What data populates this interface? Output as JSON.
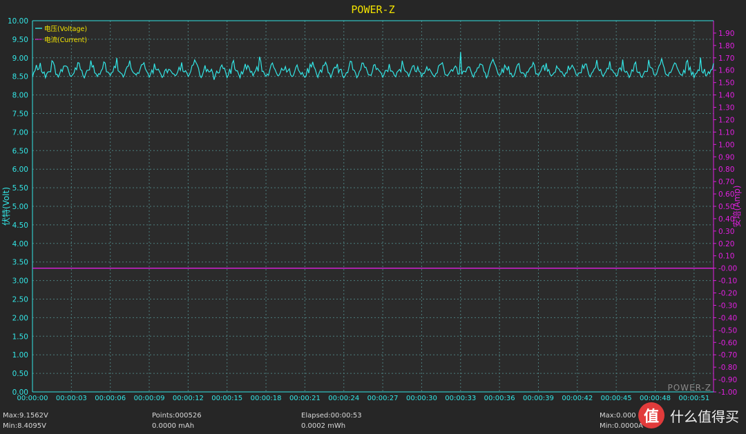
{
  "chart_data": {
    "type": "line",
    "title": "POWER-Z",
    "ylabel": "伏特(Volt)",
    "y2label": "安培(Amp)",
    "ylim": [
      0,
      10
    ],
    "y2lim": [
      -1.0,
      2.0
    ],
    "yticks": [
      "0.00",
      "0.50",
      "1.00",
      "1.50",
      "2.00",
      "2.50",
      "3.00",
      "3.50",
      "4.00",
      "4.50",
      "5.00",
      "5.50",
      "6.00",
      "6.50",
      "7.00",
      "7.50",
      "8.00",
      "8.50",
      "9.00",
      "9.50",
      "10.00"
    ],
    "y2ticks": [
      "-1.00",
      "-0.90",
      "-0.80",
      "-0.70",
      "-0.60",
      "-0.50",
      "-0.40",
      "-0.30",
      "-0.20",
      "-0.10",
      "-0.00",
      "0.10",
      "0.20",
      "0.30",
      "0.40",
      "0.50",
      "0.60",
      "0.70",
      "0.80",
      "0.90",
      "1.00",
      "1.10",
      "1.20",
      "1.30",
      "1.40",
      "1.50",
      "1.60",
      "1.70",
      "1.80",
      "1.90"
    ],
    "xticks": [
      "00:00:00",
      "00:00:03",
      "00:00:06",
      "00:00:09",
      "00:00:12",
      "00:00:15",
      "00:00:18",
      "00:00:21",
      "00:00:24",
      "00:00:27",
      "00:00:30",
      "00:00:33",
      "00:00:36",
      "00:00:39",
      "00:00:42",
      "00:00:45",
      "00:00:48",
      "00:00:51"
    ],
    "xlim_seconds": [
      0,
      52.5
    ],
    "grid": true,
    "legend_placement": "top-left",
    "series": [
      {
        "name": "电压(Voltage)",
        "axis": "left",
        "color": "#33e6e6",
        "min": 8.4095,
        "max": 9.1562,
        "baseline": 8.5,
        "period_s": 1.0
      },
      {
        "name": "电流(Current)",
        "axis": "right",
        "color": "#e020e0",
        "constant": 0.0
      }
    ]
  },
  "colors": {
    "background": "#262626",
    "plot_bg": "#2b2b2b",
    "grid": "#4d7f7f",
    "axis_left": "#33e6e6",
    "axis_right": "#e020e0",
    "title": "#f2e200"
  },
  "footer": {
    "max": "Max:9.1562V",
    "min": "Min:8.4095V",
    "points": "Points:000526",
    "mah": "0.0000 mAh",
    "elapsed": "Elapsed:00:00:53",
    "mwh": "0.0002 mWh",
    "max_current": "Max:0.000",
    "min_current": "Min:0.0000A"
  },
  "watermark": {
    "logo_text": "POWER-Z",
    "badge": "值",
    "site": "什么值得买"
  }
}
